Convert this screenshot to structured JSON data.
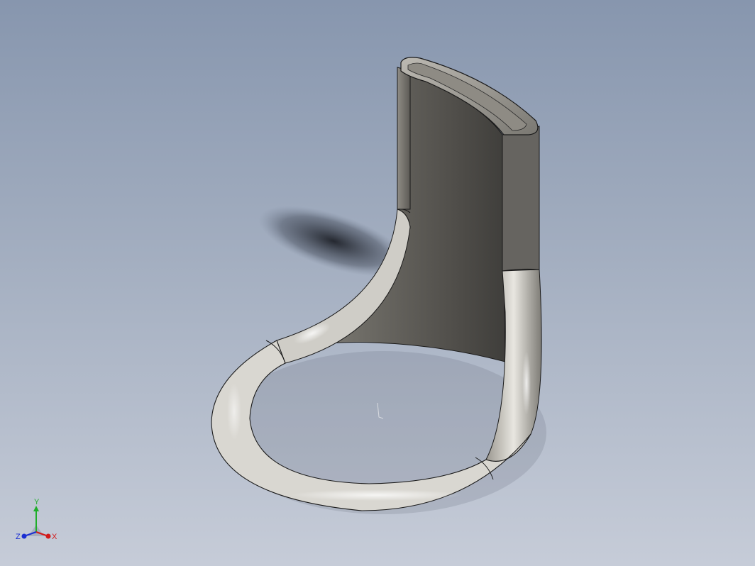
{
  "viewport": {
    "background_top": "#8796ae",
    "background_bottom": "#c6ccd8"
  },
  "model": {
    "body_color": "#6f6d68",
    "tube_color": "#d8d6d0",
    "edge_color": "#1a1a1a"
  },
  "triad": {
    "x_label": "X",
    "y_label": "Y",
    "z_label": "Z",
    "x_color": "#d21a1a",
    "y_color": "#1fae2a",
    "z_color": "#1a2ed2"
  }
}
